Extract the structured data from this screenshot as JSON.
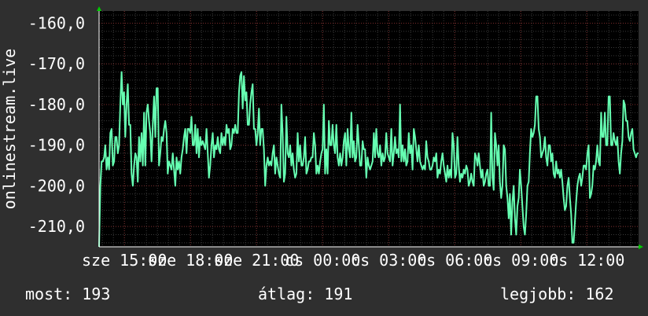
{
  "chart_data": {
    "type": "line",
    "ylabel": "onlinestream.live",
    "ylim": [
      -215,
      -157
    ],
    "y_ticks": [
      "-160,0",
      "-170,0",
      "-180,0",
      "-190,0",
      "-200,0",
      "-210,0"
    ],
    "y_tick_values": [
      -160,
      -170,
      -180,
      -190,
      -200,
      -210
    ],
    "x_ticks": [
      "sze 15:00",
      "sze 18:00",
      "sze 21:00",
      "cs 00:00",
      "cs 03:00",
      "cs 06:00",
      "cs 09:00",
      "cs 12:00"
    ],
    "x_tick_values": [
      15,
      18,
      21,
      24,
      27,
      30,
      33,
      36
    ],
    "xlim": [
      13.85,
      38.35
    ],
    "grid": true,
    "line_color": "#66ffb2",
    "y": [
      -215,
      -200,
      -194,
      -194,
      -193,
      -190,
      -196,
      -193,
      -196,
      -187,
      -186,
      -195,
      -194,
      -188,
      -188,
      -192,
      -190,
      -180,
      -172,
      -180,
      -177,
      -188,
      -180,
      -175,
      -185,
      -185,
      -197,
      -200,
      -195,
      -192,
      -193,
      -199,
      -188,
      -194,
      -187,
      -195,
      -182,
      -195,
      -182,
      -180,
      -184,
      -187,
      -194,
      -185,
      -178,
      -188,
      -176,
      -176,
      -195,
      -192,
      -188,
      -189,
      -186,
      -184,
      -187,
      -197,
      -194,
      -195,
      -196,
      -192,
      -196,
      -200,
      -193,
      -196,
      -194,
      -197,
      -193,
      -191,
      -188,
      -186,
      -192,
      -186,
      -186,
      -187,
      -183,
      -190,
      -190,
      -185,
      -192,
      -186,
      -193,
      -188,
      -190,
      -189,
      -190,
      -191,
      -186,
      -192,
      -198,
      -195,
      -190,
      -187,
      -193,
      -190,
      -191,
      -188,
      -191,
      -192,
      -187,
      -190,
      -188,
      -190,
      -185,
      -187,
      -186,
      -191,
      -190,
      -186,
      -187,
      -185,
      -187,
      -187,
      -177,
      -173,
      -172,
      -181,
      -173,
      -179,
      -177,
      -185,
      -185,
      -180,
      -177,
      -175,
      -186,
      -186,
      -190,
      -187,
      -181,
      -190,
      -186,
      -186,
      -191,
      -200,
      -195,
      -193,
      -195,
      -194,
      -195,
      -192,
      -190,
      -197,
      -193,
      -195,
      -197,
      -198,
      -180,
      -187,
      -199,
      -197,
      -183,
      -192,
      -193,
      -190,
      -195,
      -192,
      -196,
      -198,
      -197,
      -187,
      -194,
      -190,
      -195,
      -195,
      -193,
      -188,
      -197,
      -196,
      -194,
      -194,
      -193,
      -193,
      -187,
      -190,
      -197,
      -195,
      -197,
      -194,
      -192,
      -191,
      -180,
      -197,
      -191,
      -197,
      -184,
      -190,
      -190,
      -185,
      -190,
      -192,
      -185,
      -193,
      -195,
      -192,
      -195,
      -193,
      -189,
      -187,
      -195,
      -186,
      -191,
      -193,
      -182,
      -193,
      -189,
      -194,
      -193,
      -185,
      -190,
      -195,
      -195,
      -189,
      -191,
      -191,
      -198,
      -193,
      -195,
      -196,
      -195,
      -194,
      -187,
      -193,
      -186,
      -192,
      -193,
      -190,
      -195,
      -192,
      -194,
      -193,
      -187,
      -192,
      -193,
      -194,
      -186,
      -195,
      -192,
      -188,
      -192,
      -191,
      -193,
      -180,
      -194,
      -190,
      -194,
      -191,
      -195,
      -194,
      -187,
      -192,
      -190,
      -196,
      -186,
      -188,
      -191,
      -194,
      -190,
      -194,
      -195,
      -196,
      -195,
      -196,
      -189,
      -193,
      -194,
      -196,
      -196,
      -195,
      -193,
      -194,
      -192,
      -198,
      -196,
      -197,
      -194,
      -192,
      -195,
      -197,
      -199,
      -195,
      -198,
      -196,
      -198,
      -187,
      -190,
      -198,
      -197,
      -188,
      -195,
      -199,
      -197,
      -198,
      -196,
      -197,
      -195,
      -196,
      -200,
      -199,
      -197,
      -199,
      -200,
      -192,
      -193,
      -195,
      -192,
      -195,
      -198,
      -196,
      -200,
      -199,
      -197,
      -196,
      -200,
      -200,
      -182,
      -198,
      -201,
      -187,
      -190,
      -195,
      -190,
      -199,
      -203,
      -200,
      -190,
      -191,
      -200,
      -203,
      -208,
      -202,
      -212,
      -204,
      -200,
      -208,
      -212,
      -205,
      -203,
      -196,
      -200,
      -205,
      -210,
      -212,
      -207,
      -200,
      -199,
      -192,
      -186,
      -188,
      -187,
      -185,
      -178,
      -178,
      -186,
      -188,
      -193,
      -192,
      -191,
      -188,
      -193,
      -195,
      -190,
      -190,
      -194,
      -192,
      -197,
      -198,
      -194,
      -197,
      -196,
      -198,
      -196,
      -199,
      -203,
      -206,
      -205,
      -200,
      -198,
      -203,
      -207,
      -214,
      -214,
      -209,
      -204,
      -200,
      -198,
      -197,
      -200,
      -198,
      -195,
      -195,
      -196,
      -192,
      -190,
      -203,
      -202,
      -200,
      -195,
      -196,
      -194,
      -190,
      -194,
      -195,
      -182,
      -188,
      -188,
      -182,
      -190,
      -190,
      -178,
      -178,
      -190,
      -190,
      -187,
      -189,
      -190,
      -188,
      -194,
      -197,
      -192,
      -189,
      -179,
      -180,
      -184,
      -184,
      -188,
      -189,
      -187,
      -186,
      -191,
      -192,
      -193,
      -192,
      -192
    ],
    "y_points_note": ""
  },
  "stats": {
    "now": "most: 193",
    "avg": "átlag: 191",
    "best": "legjobb: 162"
  }
}
